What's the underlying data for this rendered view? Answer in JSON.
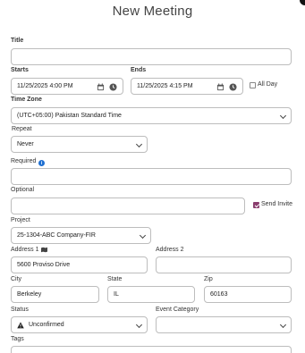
{
  "window": {
    "title": "New Meeting"
  },
  "form": {
    "title": {
      "label": "Title",
      "value": ""
    },
    "starts": {
      "label": "Starts",
      "value": "11/25/2025 4:00 PM"
    },
    "ends": {
      "label": "Ends",
      "value": "11/25/2025 4:15 PM"
    },
    "all_day": {
      "label": "All Day",
      "checked": false
    },
    "time_zone": {
      "label": "Time Zone",
      "value": "(UTC+05:00) Pakistan Standard Time"
    },
    "repeat": {
      "label": "Repeat",
      "value": "Never"
    },
    "required": {
      "label": "Required",
      "value": ""
    },
    "optional": {
      "label": "Optional",
      "value": ""
    },
    "send_invite": {
      "label": "Send Invite",
      "checked": true
    },
    "project": {
      "label": "Project",
      "value": "25-1304-ABC Company-FIR"
    },
    "address1": {
      "label": "Address 1",
      "value": "5600 Proviso Drive"
    },
    "address2": {
      "label": "Address 2",
      "value": ""
    },
    "city": {
      "label": "City",
      "value": "Berkeley"
    },
    "state": {
      "label": "State",
      "value": "IL"
    },
    "zip": {
      "label": "Zip",
      "value": "60163"
    },
    "status": {
      "label": "Status",
      "value": "Unconfirmed"
    },
    "event_category": {
      "label": "Event Category",
      "value": ""
    },
    "tags": {
      "label": "Tags"
    }
  },
  "colors": {
    "accent": "#8a3d6d",
    "info": "#1f6fd1",
    "border": "#bdbdbd"
  },
  "icons": [
    "calendar-icon",
    "clock-icon",
    "chevron-down-icon",
    "info-icon",
    "map-icon",
    "warning-icon"
  ]
}
